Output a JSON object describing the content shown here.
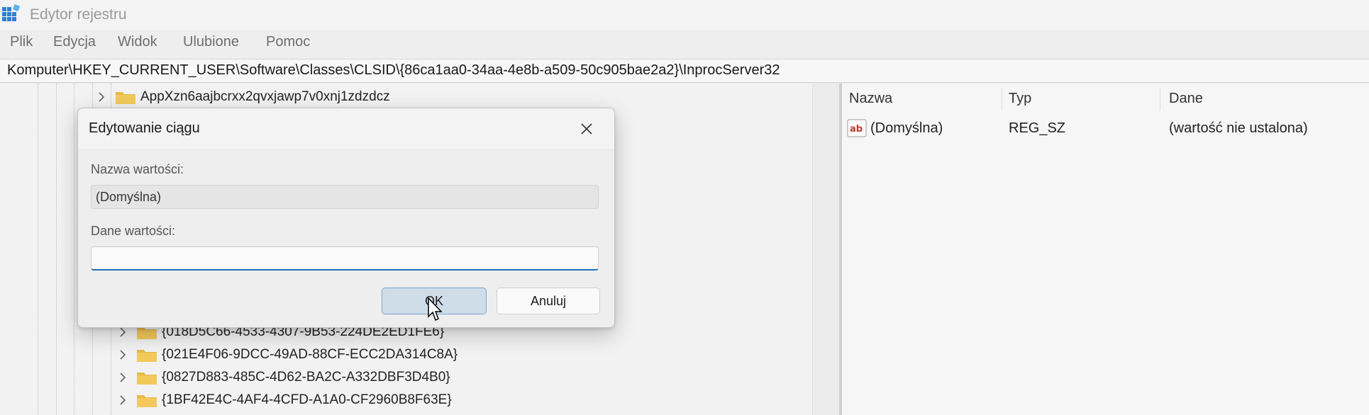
{
  "window": {
    "title": "Edytor rejestru"
  },
  "menu": [
    "Plik",
    "Edycja",
    "Widok",
    "Ulubione",
    "Pomoc"
  ],
  "address": "Komputer\\HKEY_CURRENT_USER\\Software\\Classes\\CLSID\\{86ca1aa0-34aa-4e8b-a509-50c905bae2a2}\\InprocServer32",
  "tree": {
    "top_item": "AppXzn6aajbcrxx2qvxjawp7v0xnj1zdzdcz",
    "items": [
      "{018D5C66-4533-4307-9B53-224DE2ED1FE6}",
      "{021E4F06-9DCC-49AD-88CF-ECC2DA314C8A}",
      "{0827D883-485C-4D62-BA2C-A332DBF3D4B0}",
      "{1BF42E4C-4AF4-4CFD-A1A0-CF2960B8F63E}"
    ]
  },
  "values": {
    "headers": {
      "name": "Nazwa",
      "type": "Typ",
      "data": "Dane"
    },
    "rows": [
      {
        "name": "(Domyślna)",
        "type": "REG_SZ",
        "data": "(wartość nie ustalona)"
      }
    ]
  },
  "dialog": {
    "title": "Edytowanie ciągu",
    "name_label": "Nazwa wartości:",
    "name_value": "(Domyślna)",
    "data_label": "Dane wartości:",
    "data_value": "",
    "ok_label": "OK",
    "cancel_label": "Anuluj"
  },
  "colors": {
    "accent": "#1f6fb8",
    "folder": "#e8b94a",
    "ok_button": "#cfdde9"
  }
}
